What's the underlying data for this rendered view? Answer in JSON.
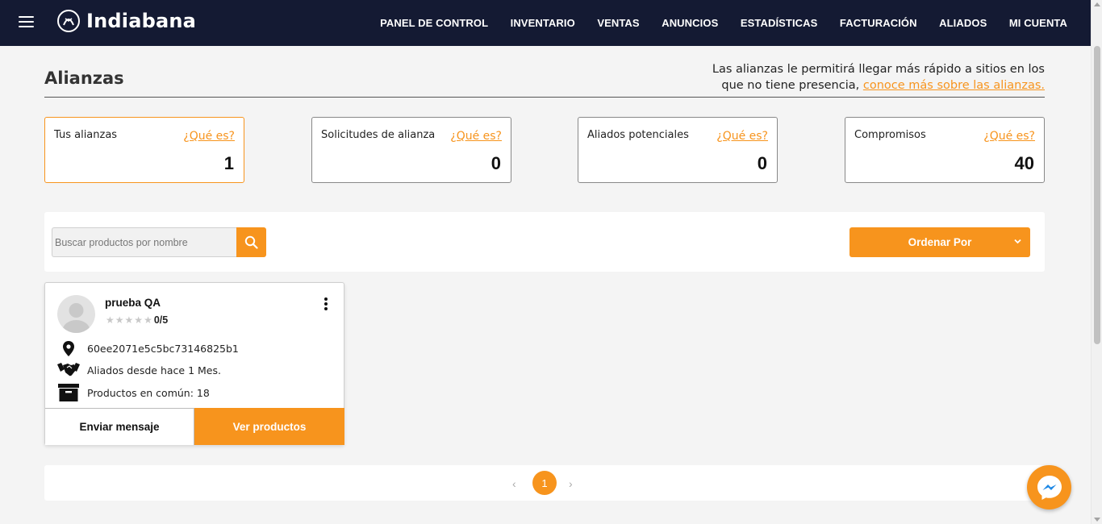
{
  "brand": {
    "name": "Indiabana",
    "accent_color": "#f7941d",
    "header_color": "#141a33"
  },
  "nav": {
    "items": [
      "PANEL DE CONTROL",
      "INVENTARIO",
      "VENTAS",
      "ANUNCIOS",
      "ESTADÍSTICAS",
      "FACTURACIÓN",
      "ALIADOS",
      "MI CUENTA"
    ]
  },
  "page": {
    "title": "Alianzas",
    "intro_text": "Las alianzas le permitirá llegar más rápido a sitios en los que no tiene presencia,",
    "intro_link": "conoce más sobre las alianzas."
  },
  "stats": [
    {
      "label": "Tus alianzas",
      "help": "¿Qué es?",
      "value": "1"
    },
    {
      "label": "Solicitudes de alianza",
      "help": "¿Qué es?",
      "value": "0"
    },
    {
      "label": "Aliados potenciales",
      "help": "¿Qué es?",
      "value": "0"
    },
    {
      "label": "Compromisos",
      "help": "¿Qué es?",
      "value": "40"
    }
  ],
  "search": {
    "placeholder": "Buscar productos por nombre",
    "sort_label": "Ordenar Por"
  },
  "ally": {
    "name": "prueba QA",
    "rating_text": "0/5",
    "rating_value": 0,
    "rating_max": 5,
    "location": "60ee2071e5c5bc73146825b1",
    "allied_since": "Aliados desde hace 1 Mes.",
    "common_products": "Productos en común: 18",
    "send_message_label": "Enviar mensaje",
    "view_products_label": "Ver productos"
  },
  "pagination": {
    "current_page": "1",
    "prev_icon": "chevron-left-icon",
    "next_icon": "chevron-right-icon"
  },
  "icons": {
    "menu": "hamburger-icon",
    "search": "search-icon",
    "location": "map-pin-icon",
    "handshake": "handshake-icon",
    "box": "archive-box-icon",
    "messenger": "messenger-icon"
  }
}
